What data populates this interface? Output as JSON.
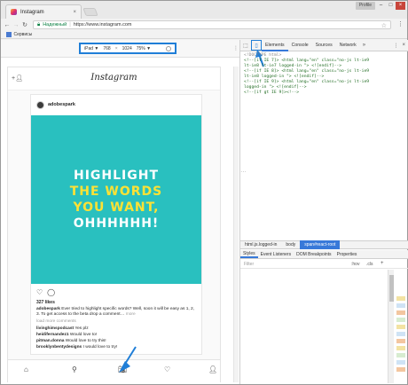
{
  "browser": {
    "tab_title": "Instagram",
    "tab_close": "×",
    "profile": "Profile",
    "window_controls": {
      "minimize": "–",
      "maximize": "□",
      "close": "×"
    },
    "secure_label": "Надежный",
    "url": "https://www.instagram.com",
    "bookmarks_label": "Сервисы",
    "menu_icon": "⋮",
    "star_icon": "☆"
  },
  "device_toolbar": {
    "device": "iPad ▼",
    "width": "768",
    "times": "×",
    "height": "1024",
    "zoom": "75% ▼"
  },
  "instagram": {
    "logo": "Instagram",
    "username": "adobespark",
    "image_lines": [
      "HIGHLIGHT",
      "THE WORDS",
      "YOU WANT,",
      "OHHHHHH!"
    ],
    "likes": "327 likes",
    "caption_user": "adobespark",
    "caption_text": "Ever tried to highlight specific words? Well, soon it will be easy as 1, 2, 3. To get access to the beta drop a comment…",
    "caption_more": "more",
    "load_more": "load more comments",
    "comments": [
      {
        "user": "livinghimspodcast",
        "text": "Yes plz"
      },
      {
        "user": "heidifernandez1",
        "text": "Would love to!"
      },
      {
        "user": "pitman.donna",
        "text": "Would love to try this!"
      },
      {
        "user": "brooklynbentydesigns",
        "text": "I would love to try!"
      }
    ]
  },
  "devtools": {
    "tabs": [
      "Elements",
      "Console",
      "Sources",
      "Network"
    ],
    "more": "»",
    "code_lines": [
      "<!DOCTYPE html>",
      "<!--[if IE 7]>      <html lang=\"en\" class=\"no-js lt-ie9",
      "lt-ie8 lt-ie7 logged-in \"> <![endif]-->",
      "<!--[if IE 8]>      <html lang=\"en\" class=\"no-js lt-ie9",
      "lt-ie8 logged-in \"> <![endif]-->",
      "<!--[if IE 9]>      <html lang=\"en\" class=\"no-js lt-ie9",
      "logged-in \"> <![endif]-->",
      "<!--[if gt IE 9]><!-->"
    ],
    "ellipsis": "…",
    "breadcrumbs": [
      "html.js.logged-in",
      "body",
      "span#react-root"
    ],
    "sub_tabs": [
      "Styles",
      "Event Listeners",
      "DOM Breakpoints",
      "Properties"
    ],
    "filter_placeholder": "Filter",
    "hov": ":hov",
    "cls": ".cls",
    "plus": "+"
  },
  "colors": {
    "accent": "#1f7ed7",
    "post_bg": "#29c0bf",
    "highlight": "#ffe234"
  }
}
